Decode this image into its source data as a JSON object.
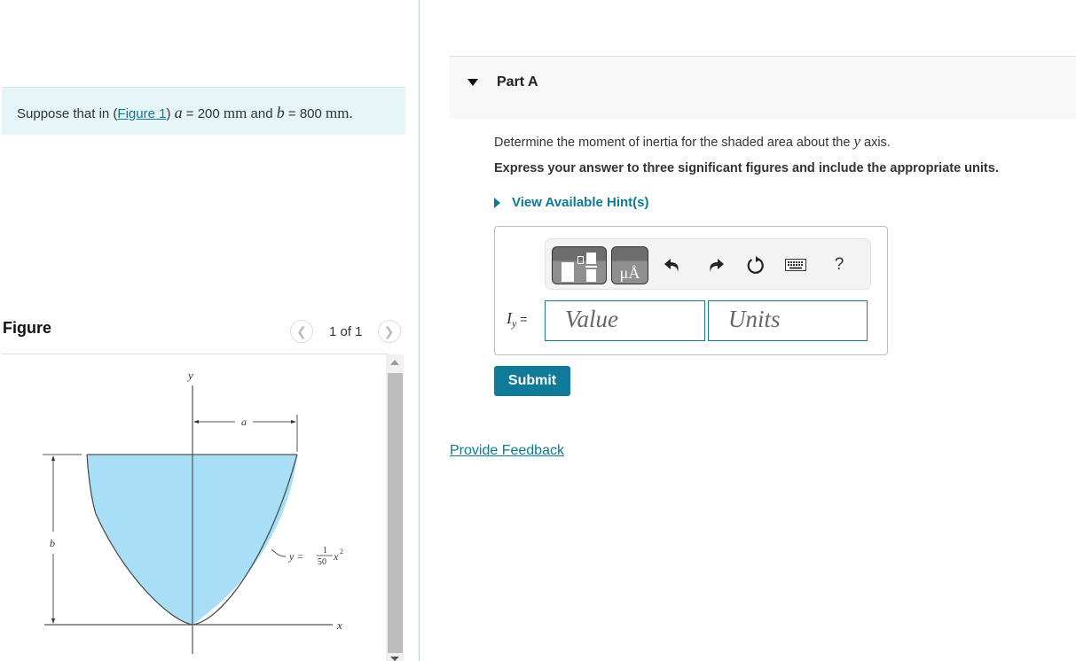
{
  "intro": {
    "prefix": "Suppose that in (",
    "figure_link": "Figure 1",
    "suffix": ")",
    "var_a": "a",
    "eq1": " = 200 ",
    "unit1": "mm",
    "and": " and ",
    "var_b": "b",
    "eq2": " = 800 ",
    "unit2": "mm",
    "period": "."
  },
  "figure": {
    "title": "Figure",
    "pager_text": "1 of 1",
    "prev_icon": "chevron-left-icon",
    "next_icon": "chevron-right-icon",
    "diagram": {
      "axis_y": "y",
      "axis_x": "x",
      "dim_a": "a",
      "dim_b": "b",
      "curve_lhs": "y =",
      "curve_num": "1",
      "curve_den": "50",
      "curve_rhs": "x",
      "curve_exp": "2",
      "fill_color": "#a9dff6"
    }
  },
  "part": {
    "title": "Part A",
    "question_prefix": "Determine the moment of inertia for the shaded area about the ",
    "question_var": "y",
    "question_suffix": " axis.",
    "instruction": "Express your answer to three significant figures and include the appropriate units.",
    "hints_label": "View Available Hint(s)"
  },
  "toolbar": {
    "templates_icon": "templates-icon",
    "units_glyph": "μÅ",
    "undo_icon": "undo-icon",
    "redo_icon": "redo-icon",
    "reset_icon": "reset-icon",
    "keyboard_icon": "keyboard-icon",
    "help_label": "?"
  },
  "answer": {
    "label_var": "I",
    "label_sub": "y",
    "label_eq": " =",
    "value_placeholder": "Value",
    "units_placeholder": "Units"
  },
  "submit_label": "Submit",
  "feedback_label": "Provide Feedback",
  "colors": {
    "accent": "#0f7b99",
    "link": "#0d7a96",
    "intro_bg": "#e5f4f6"
  }
}
